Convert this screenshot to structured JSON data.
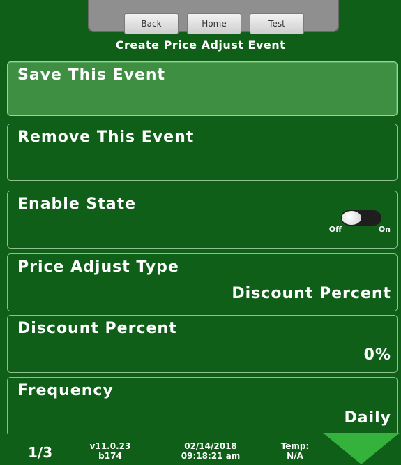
{
  "nav": {
    "back_label": "Back",
    "home_label": "Home",
    "test_label": "Test"
  },
  "title": "Create Price Adjust Event",
  "rows": {
    "save": {
      "label": "Save This Event"
    },
    "remove": {
      "label": "Remove This Event"
    },
    "enable": {
      "label": "Enable State",
      "toggle_state": "off",
      "off_label": "Off",
      "on_label": "On"
    },
    "type": {
      "label": "Price Adjust Type",
      "value": "Discount Percent"
    },
    "discount": {
      "label": "Discount Percent",
      "value": "0%"
    },
    "frequency": {
      "label": "Frequency",
      "value": "Daily"
    }
  },
  "footer": {
    "page": "1/3",
    "version": "v11.0.23",
    "build": "b174",
    "date": "02/14/2018",
    "time": "09:18:21 am",
    "temp_label": "Temp:",
    "temp_value": "N/A"
  },
  "icons": {
    "scroll_down": "down-arrow-icon"
  },
  "colors": {
    "background": "#0f5f18",
    "highlight": "#3f8f43",
    "arrow": "#35b23b",
    "text": "#ffffff"
  }
}
